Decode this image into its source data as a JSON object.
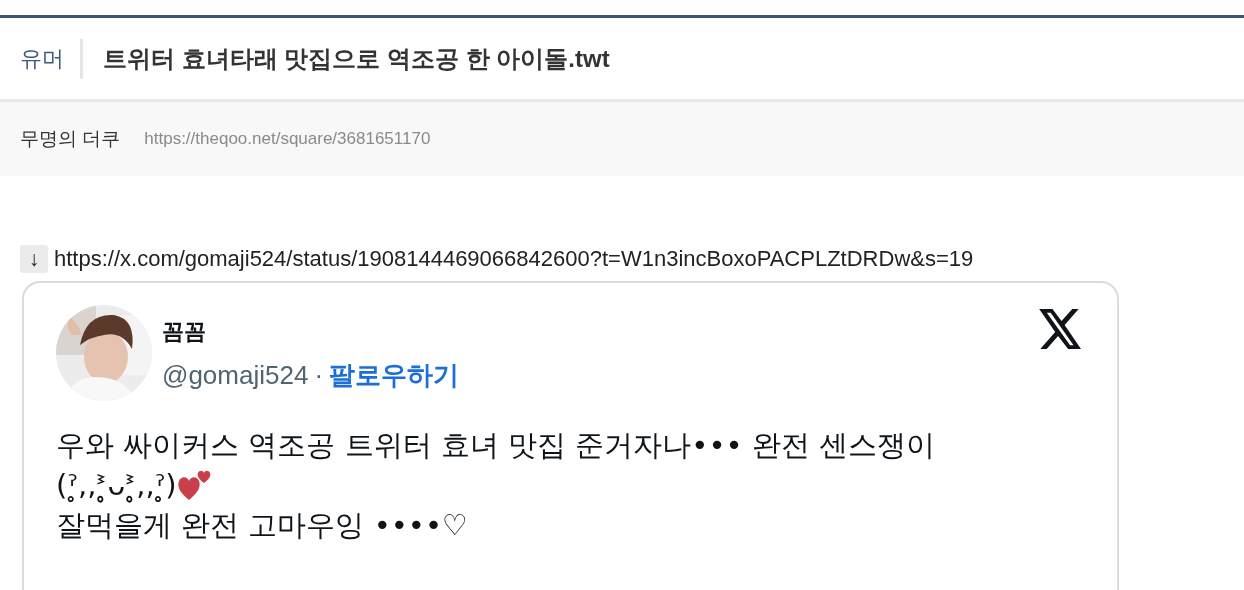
{
  "post": {
    "category": "유머",
    "title": "트위터 효녀타래 맛집으로 역조공 한 아이돌.twt",
    "author": "무명의 더쿠",
    "url": "https://theqoo.net/square/3681651170"
  },
  "link": {
    "icon": "↓",
    "url": "https://x.com/gomaji524/status/1908144469066842600?t=W1n3incBoxoPACPLZtDRDw&s=19"
  },
  "tweet": {
    "name": "꼼꼼",
    "handle": "@gomaji524",
    "separator": "·",
    "follow": "팔로우하기",
    "lines": [
      {
        "text": "우와 싸이커스 역조공 트위터 효녀 맛집 준거자나••• 완전 센스쟁이",
        "hearts": false
      },
      {
        "text": "(ˀ̥,,ᕑ̥ᴗᕑ̥,,ˀ̥)",
        "hearts": true
      },
      {
        "text": "잘먹을게 완전 고마우잉 ••••♡",
        "hearts": false
      }
    ]
  }
}
